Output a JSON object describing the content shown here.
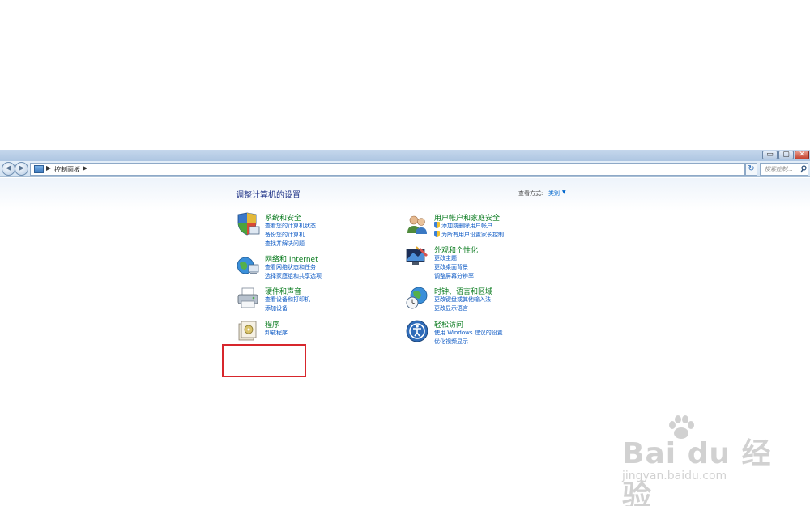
{
  "window": {
    "controls": {
      "minimize": "▭",
      "maximize": "▢",
      "close": "✕"
    }
  },
  "navbar": {
    "back_icon": "back-arrow-icon",
    "forward_icon": "forward-arrow-icon",
    "breadcrumb": "控制面板",
    "breadcrumb_arrow": "▶",
    "dropdown_arrow": "▾",
    "refresh_icon": "↻",
    "search_placeholder": "搜索控制..."
  },
  "main": {
    "title": "调整计算机的设置",
    "view_by_label": "查看方式:",
    "view_by_value": "类别",
    "view_by_arrow": "▼"
  },
  "categories": [
    {
      "title": "系统和安全",
      "icon": "shield-computer-icon",
      "links": [
        "查看您的计算机状态",
        "备份您的计算机",
        "查找并解决问题"
      ]
    },
    {
      "title": "网络和 Internet",
      "icon": "network-globe-icon",
      "links": [
        "查看网络状态和任务",
        "选择家庭组和共享选项"
      ]
    },
    {
      "title": "硬件和声音",
      "icon": "printer-icon",
      "links": [
        "查看设备和打印机",
        "添加设备"
      ]
    },
    {
      "title": "程序",
      "icon": "programs-icon",
      "links": [
        "卸载程序"
      ]
    },
    {
      "title": "用户帐户和家庭安全",
      "icon": "users-icon",
      "links": [
        "添加或删除用户帐户",
        "为所有用户设置家长控制"
      ]
    },
    {
      "title": "外观和个性化",
      "icon": "display-paint-icon",
      "links": [
        "更改主题",
        "更改桌面背景",
        "调整屏幕分辨率"
      ]
    },
    {
      "title": "时钟、语言和区域",
      "icon": "globe-clock-icon",
      "links": [
        "更改键盘或其他输入法",
        "更改显示语言"
      ]
    },
    {
      "title": "轻松访问",
      "icon": "ease-of-access-icon",
      "links": [
        "使用 Windows 建议的设置",
        "优化视频显示"
      ]
    }
  ],
  "watermark": {
    "brand": "Bai du 经验",
    "url": "jingyan.baidu.com"
  },
  "colors": {
    "category_title": "#0a7b1f",
    "link": "#0b58c4",
    "page_title": "#1e3287",
    "highlight": "#d7262c"
  }
}
